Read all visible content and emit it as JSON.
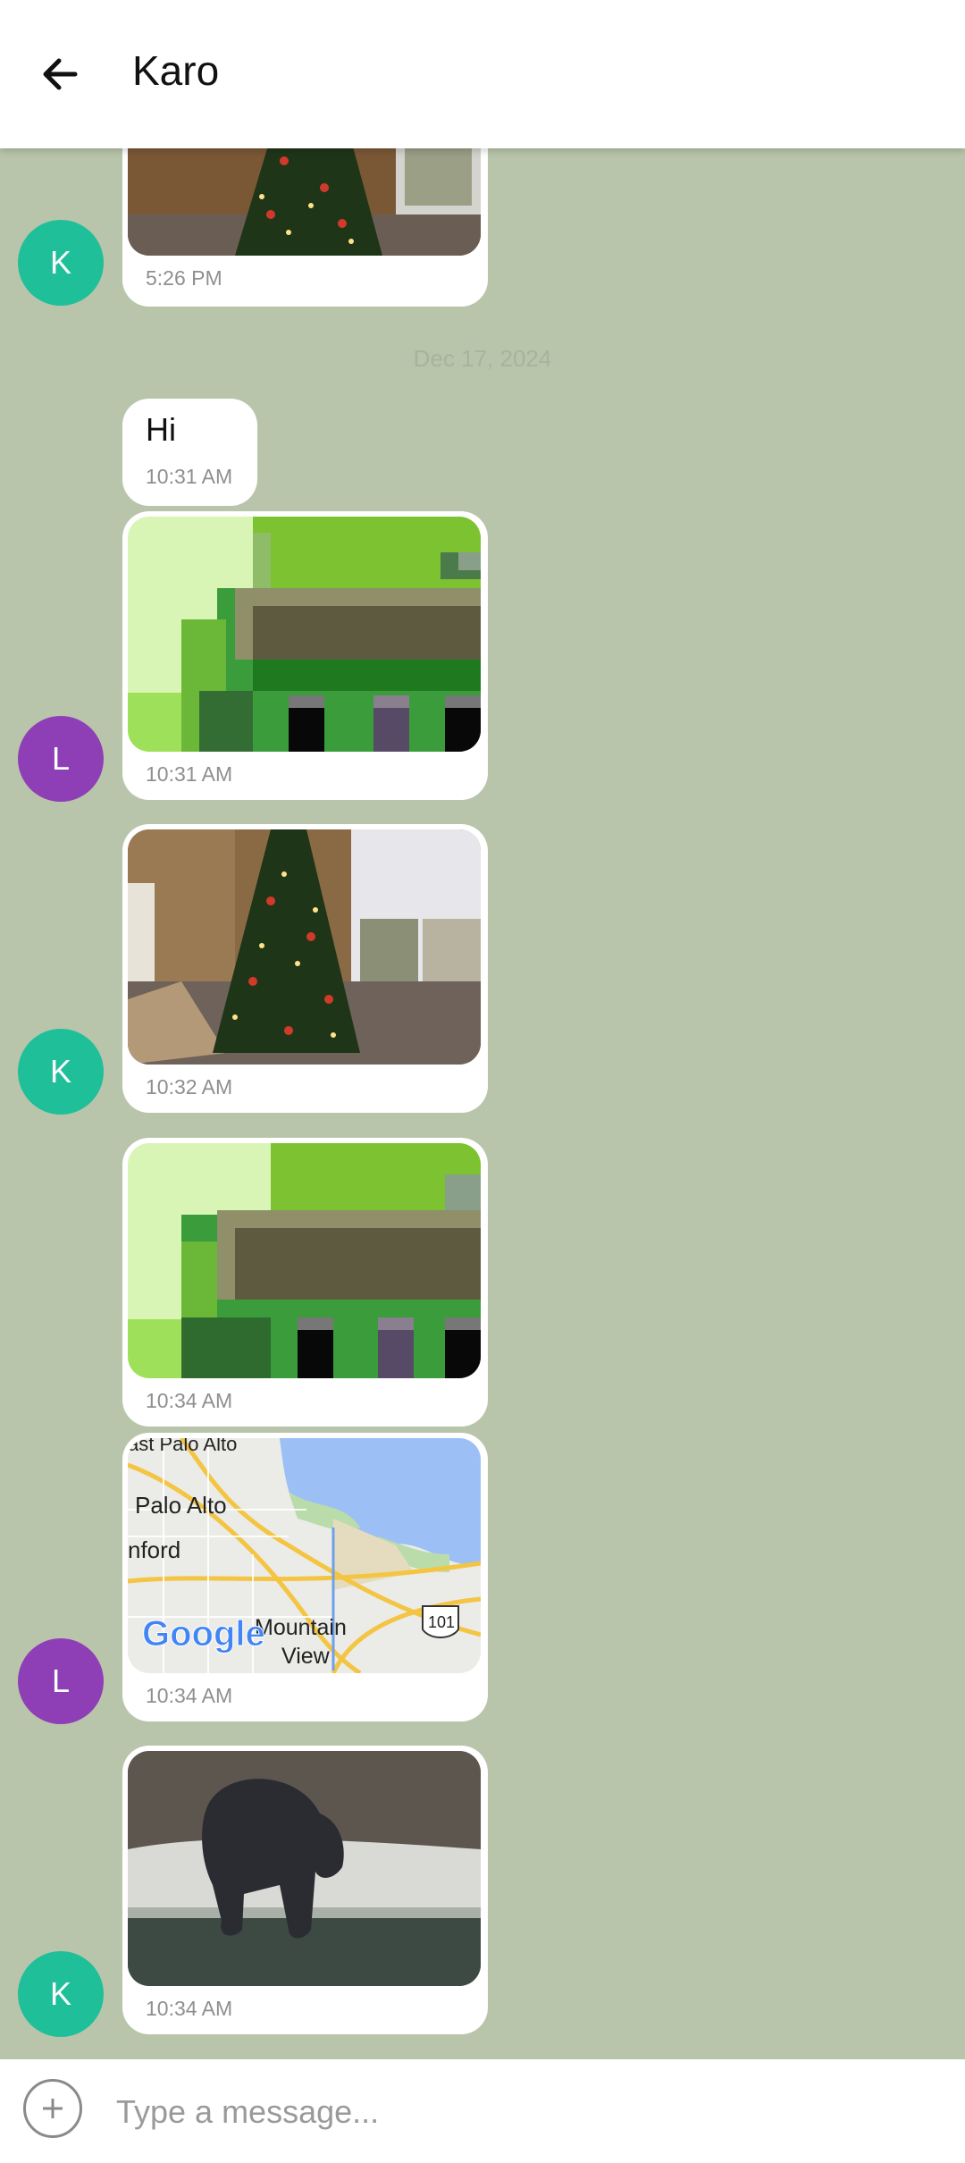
{
  "header": {
    "title": "Karo"
  },
  "date_separator": "Dec 17, 2024",
  "messages": {
    "m0": {
      "time": "5:26 PM",
      "avatar": "K"
    },
    "m1": {
      "text": "Hi",
      "time": "10:31 AM"
    },
    "m2": {
      "time": "10:31 AM",
      "avatar": "L"
    },
    "m3": {
      "time": "10:32 AM",
      "avatar": "K"
    },
    "m4": {
      "time": "10:34 AM"
    },
    "m5": {
      "time": "10:34 AM",
      "avatar": "L"
    },
    "m6": {
      "time": "10:34 AM",
      "avatar": "K"
    }
  },
  "map_labels": {
    "top": "ast Palo Alto",
    "palo_alto": "Palo Alto",
    "stanford": "nford",
    "mountain": "Mountain",
    "view": "View",
    "highway": "101",
    "logo": "Google"
  },
  "composer": {
    "placeholder": "Type a message..."
  },
  "colors": {
    "background": "#b9c5ab",
    "avatar_k": "#1fbf9a",
    "avatar_l": "#8e3fb6"
  }
}
